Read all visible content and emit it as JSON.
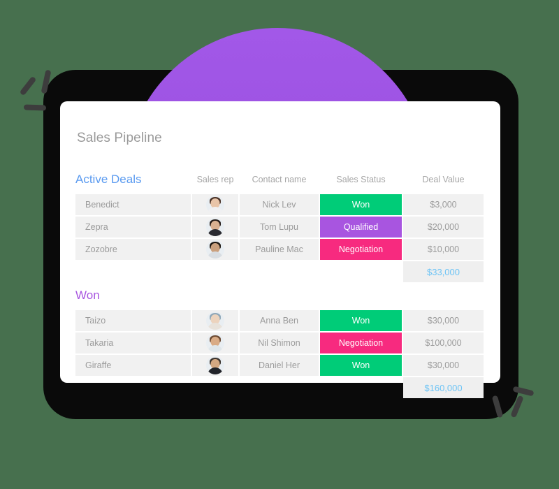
{
  "page": {
    "background_color": "#47704e",
    "device_color": "#0a0a0a",
    "dome_color": "#9d52e0"
  },
  "card": {
    "title": "Sales Pipeline",
    "background_color": "#ffffff"
  },
  "table": {
    "columns": [
      {
        "key": "deal",
        "label": ""
      },
      {
        "key": "rep",
        "label": "Sales rep"
      },
      {
        "key": "contact",
        "label": "Contact name"
      },
      {
        "key": "status",
        "label": "Sales Status"
      },
      {
        "key": "value",
        "label": "Deal Value"
      }
    ],
    "status_colors": {
      "Won": "#00cc78",
      "Qualified": "#a855e0",
      "Negotiation": "#f72a7f"
    },
    "section_colors": {
      "Active Deals": "#5b9bf0",
      "Won": "#a855e0"
    },
    "subtotal_color": "#6ec4f5",
    "sections": [
      {
        "label": "Active Deals",
        "rows": [
          {
            "deal": "Benedict",
            "contact": "Nick Lev",
            "status": "Won",
            "value": "$3,000"
          },
          {
            "deal": "Zepra",
            "contact": "Tom Lupu",
            "status": "Qualified",
            "value": "$20,000"
          },
          {
            "deal": "Zozobre",
            "contact": "Pauline Mac",
            "status": "Negotiation",
            "value": "$10,000"
          }
        ],
        "subtotal": "$33,000"
      },
      {
        "label": "Won",
        "rows": [
          {
            "deal": "Taizo",
            "contact": "Anna Ben",
            "status": "Won",
            "value": "$30,000"
          },
          {
            "deal": "Takaria",
            "contact": "Nil Shimon",
            "status": "Negotiation",
            "value": "$100,000"
          },
          {
            "deal": "Giraffe",
            "contact": "Daniel Her",
            "status": "Won",
            "value": "$30,000"
          }
        ],
        "subtotal": "$160,000"
      }
    ]
  },
  "avatars": [
    {
      "name": "avatar-benedict",
      "skin": "#e8c4a8",
      "hair": "#4a3328",
      "body": "#f0f0f2"
    },
    {
      "name": "avatar-zepra",
      "skin": "#d9b191",
      "hair": "#241c18",
      "body": "#2a2a30"
    },
    {
      "name": "avatar-zozobre",
      "skin": "#caa07e",
      "hair": "#1d1712",
      "body": "#d8dde2"
    },
    {
      "name": "avatar-taizo",
      "skin": "#ecd3bd",
      "hair": "#8fa7b8",
      "body": "#e8e2da"
    },
    {
      "name": "avatar-takaria",
      "skin": "#d9ab85",
      "hair": "#6b4a33",
      "body": "#dfe6ea"
    },
    {
      "name": "avatar-giraffe",
      "skin": "#d4a882",
      "hair": "#3a332e",
      "body": "#22242a"
    }
  ]
}
